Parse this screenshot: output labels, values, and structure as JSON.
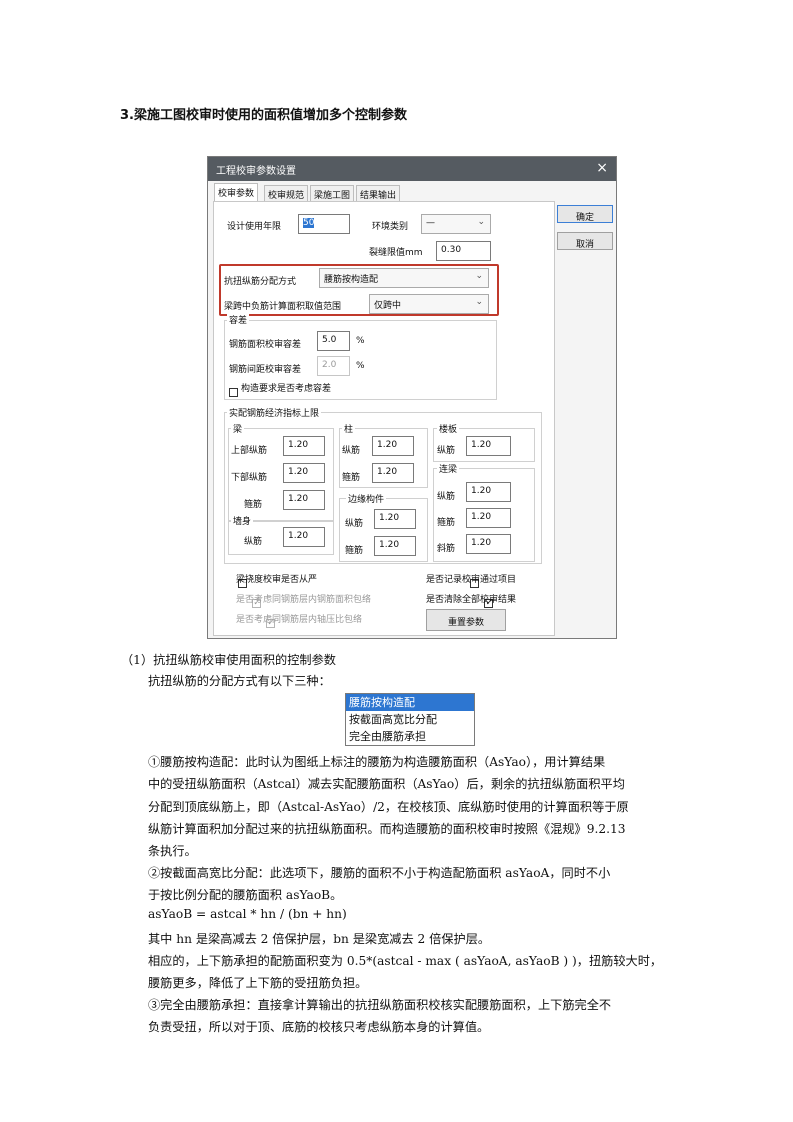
{
  "heading": "3.梁施工图校审时使用的面积值增加多个控制参数",
  "dialog": {
    "title": "工程校审参数设置",
    "close": "×",
    "tabs": [
      "校审参数",
      "校审规范",
      "梁施工图",
      "结果输出"
    ],
    "buttons": {
      "ok": "确定",
      "cancel": "取消",
      "reset": "重置参数"
    },
    "design_life": {
      "label": "设计使用年限",
      "value": "50"
    },
    "env_category": {
      "label": "环境类别",
      "value": "—"
    },
    "crack_limit": {
      "label": "裂缝限值mm",
      "value": "0.30"
    },
    "torsion_method": {
      "label": "抗扭纵筋分配方式",
      "value": "腰筋按构造配"
    },
    "neg_rebar_range": {
      "label": "梁跨中负筋计算面积取值范围",
      "value": "仅跨中"
    },
    "tolerance": {
      "title": "容差",
      "area_label": "钢筋面积校审容差",
      "area_value": "5.0",
      "area_unit": "%",
      "spacing_label": "钢筋间距校审容差",
      "spacing_value": "2.0",
      "spacing_unit": "%",
      "construct_check": "构造要求是否考虑容差"
    },
    "econ": {
      "title": "实配钢筋经济指标上限",
      "beam": {
        "title": "梁",
        "top_label": "上部纵筋",
        "top": "1.20",
        "bot_label": "下部纵筋",
        "bot": "1.20",
        "stir_label": "箍筋",
        "stir": "1.20"
      },
      "wall": {
        "title": "墙身",
        "long_label": "纵筋",
        "long": "1.20"
      },
      "column": {
        "title": "柱",
        "long_label": "纵筋",
        "long": "1.20",
        "stir_label": "箍筋",
        "stir": "1.20"
      },
      "edge": {
        "title": "边缘构件",
        "long_label": "纵筋",
        "long": "1.20",
        "stir_label": "箍筋",
        "stir": "1.20"
      },
      "slab": {
        "title": "楼板",
        "long_label": "纵筋",
        "long": "1.20"
      },
      "link": {
        "title": "连梁",
        "long_label": "纵筋",
        "long": "1.20",
        "stir_label": "箍筋",
        "stir": "1.20",
        "diag_label": "斜筋",
        "diag": "1.20"
      }
    },
    "checks": {
      "deflection": "梁挠度校审是否从严",
      "same_layer_area": "是否考虑同钢筋层内钢筋面积包络",
      "same_layer_axial": "是否考虑同钢筋层内轴压比包络",
      "record_pass": "是否记录校审通过项目",
      "clear_results": "是否清除全部校审结果"
    }
  },
  "options_list": [
    "腰筋按构造配",
    "按截面高宽比分配",
    "完全由腰筋承担"
  ],
  "body": {
    "sub1": "（1）抗扭纵筋校审使用面积的控制参数",
    "intro": "抗扭纵筋的分配方式有以下三种：",
    "p1": [
      "①腰筋按构造配：此时认为图纸上标注的腰筋为构造腰筋面积（AsYao），用计算结果",
      "中的受扭纵筋面积（Astcal）减去实配腰筋面积（AsYao）后，剩余的抗扭纵筋面积平均",
      "分配到顶底纵筋上，即（Astcal-AsYao）/2，在校核顶、底纵筋时使用的计算面积等于原",
      "纵筋计算面积加分配过来的抗扭纵筋面积。而构造腰筋的面积校审时按照《混规》9.2.13",
      "条执行。"
    ],
    "p2": [
      "②按截面高宽比分配：此选项下，腰筋的面积不小于构造配筋面积 asYaoA，同时不小",
      "于按比例分配的腰筋面积 asYaoB。"
    ],
    "formula": "asYaoB = astcal * hn / (bn + hn)",
    "p3": [
      "其中  hn  是梁高减去 2 倍保护层，bn  是梁宽减去 2 倍保护层。",
      "相应的，上下筋承担的配筋面积变为 0.5*(astcal - max ( asYaoA, asYaoB ) )，扭筋较大时，",
      "腰筋更多，降低了上下筋的受扭筋负担。",
      "③完全由腰筋承担：直接拿计算输出的抗扭纵筋面积校核实配腰筋面积，上下筋完全不",
      "负责受扭，所以对于顶、底筋的校核只考虑纵筋本身的计算值。"
    ]
  },
  "colors": {
    "title_bar": "#555b61",
    "highlight_border": "#c0392b",
    "list_selection": "#2d76d1"
  }
}
